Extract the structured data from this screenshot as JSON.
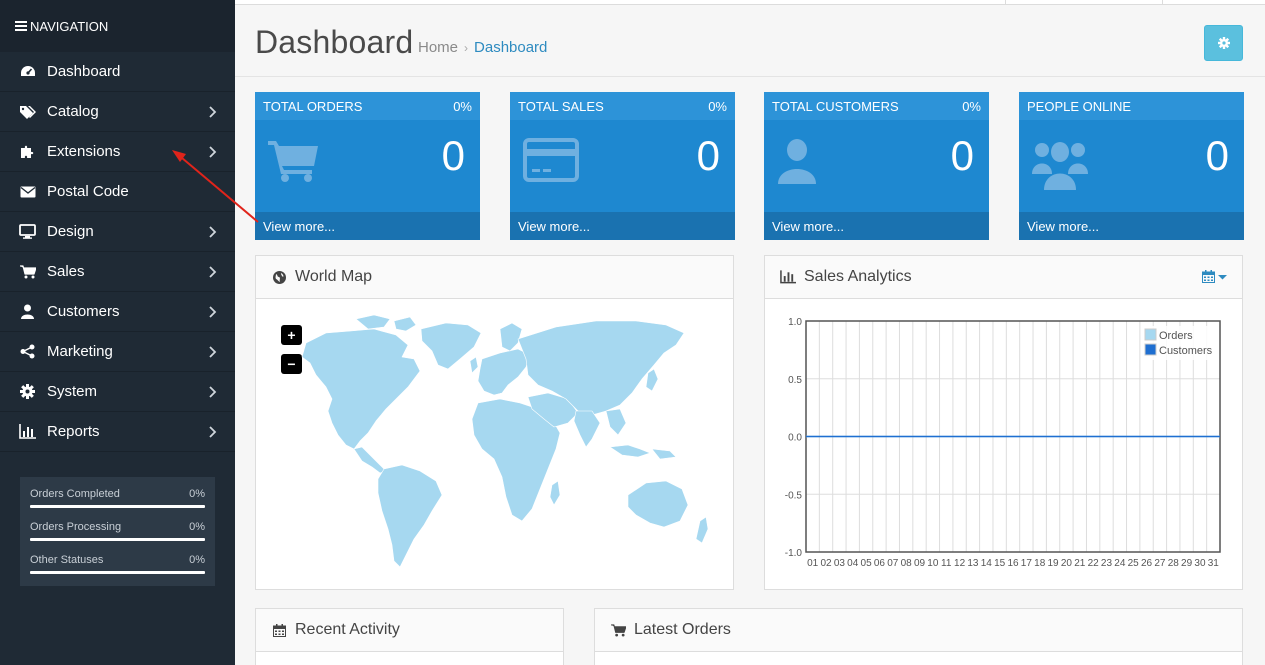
{
  "sidebar": {
    "header": "NAVIGATION",
    "items": [
      {
        "label": "Dashboard",
        "icon": "dashboard-icon",
        "has_submenu": false
      },
      {
        "label": "Catalog",
        "icon": "tags-icon",
        "has_submenu": true
      },
      {
        "label": "Extensions",
        "icon": "puzzle-icon",
        "has_submenu": true
      },
      {
        "label": "Postal Code",
        "icon": "envelope-icon",
        "has_submenu": false
      },
      {
        "label": "Design",
        "icon": "monitor-icon",
        "has_submenu": true
      },
      {
        "label": "Sales",
        "icon": "cart-icon",
        "has_submenu": true
      },
      {
        "label": "Customers",
        "icon": "user-icon",
        "has_submenu": true
      },
      {
        "label": "Marketing",
        "icon": "share-icon",
        "has_submenu": true
      },
      {
        "label": "System",
        "icon": "gear-icon",
        "has_submenu": true
      },
      {
        "label": "Reports",
        "icon": "bar-chart-icon",
        "has_submenu": true
      }
    ],
    "status": [
      {
        "label": "Orders Completed",
        "value": "0%"
      },
      {
        "label": "Orders Processing",
        "value": "0%"
      },
      {
        "label": "Other Statuses",
        "value": "0%"
      }
    ]
  },
  "header": {
    "title": "Dashboard",
    "breadcrumb": {
      "home": "Home",
      "separator": "›",
      "current": "Dashboard"
    }
  },
  "tiles": [
    {
      "title": "TOTAL ORDERS",
      "percent": "0%",
      "value": "0",
      "link": "View more...",
      "icon": "cart-icon"
    },
    {
      "title": "TOTAL SALES",
      "percent": "0%",
      "value": "0",
      "link": "View more...",
      "icon": "credit-card-icon"
    },
    {
      "title": "TOTAL CUSTOMERS",
      "percent": "0%",
      "value": "0",
      "link": "View more...",
      "icon": "user-icon"
    },
    {
      "title": "PEOPLE ONLINE",
      "percent": "",
      "value": "0",
      "link": "View more...",
      "icon": "users-icon"
    }
  ],
  "panels": {
    "world_map": {
      "title": "World Map",
      "zoom_in": "+",
      "zoom_out": "−"
    },
    "sales_analytics": {
      "title": "Sales Analytics"
    },
    "recent_activity": {
      "title": "Recent Activity"
    },
    "latest_orders": {
      "title": "Latest Orders"
    }
  },
  "colors": {
    "sidebar_bg": "#1f2a35",
    "tile_bg": "#1e88d0",
    "map_land": "#a6d8f0",
    "accent": "#2e8bc0",
    "settings_button": "#5bc0de"
  },
  "chart_data": {
    "type": "line",
    "title": "",
    "x": [
      "01",
      "02",
      "03",
      "04",
      "05",
      "06",
      "07",
      "08",
      "09",
      "10",
      "11",
      "12",
      "13",
      "14",
      "15",
      "16",
      "17",
      "18",
      "19",
      "20",
      "21",
      "22",
      "23",
      "24",
      "25",
      "26",
      "27",
      "28",
      "29",
      "30",
      "31"
    ],
    "series": [
      {
        "name": "Orders",
        "color": "#a6d8f0",
        "values": [
          0,
          0,
          0,
          0,
          0,
          0,
          0,
          0,
          0,
          0,
          0,
          0,
          0,
          0,
          0,
          0,
          0,
          0,
          0,
          0,
          0,
          0,
          0,
          0,
          0,
          0,
          0,
          0,
          0,
          0,
          0
        ]
      },
      {
        "name": "Customers",
        "color": "#1f6fd1",
        "values": [
          0,
          0,
          0,
          0,
          0,
          0,
          0,
          0,
          0,
          0,
          0,
          0,
          0,
          0,
          0,
          0,
          0,
          0,
          0,
          0,
          0,
          0,
          0,
          0,
          0,
          0,
          0,
          0,
          0,
          0,
          0
        ]
      }
    ],
    "yticks": [
      "1.0",
      "0.5",
      "0.0",
      "-0.5",
      "-1.0"
    ],
    "ylim": [
      -1,
      1
    ],
    "grid": true,
    "legend": "top-right"
  }
}
